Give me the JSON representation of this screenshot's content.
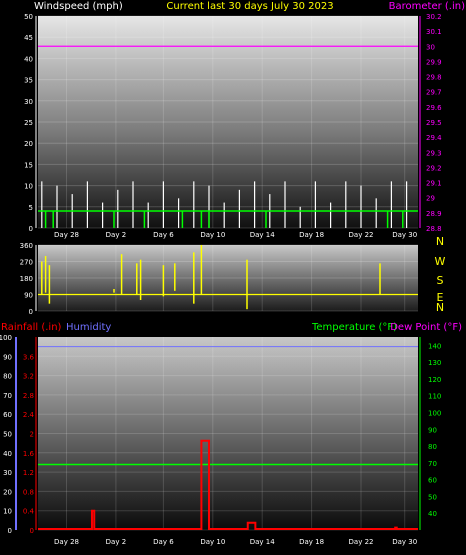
{
  "header": {
    "left": "Windspeed (mph)",
    "center": "Current last 30 days July 30 2023",
    "right": "Barometer (.in)"
  },
  "mid_header": {
    "rain": "Rainfall (.in)",
    "humidity": "Humidity",
    "temperature": "Temperature (°F)",
    "dew": "Dew Point (°F)"
  },
  "colors": {
    "wind": "#ffffff",
    "gust_line": "#ffffff",
    "wind_avg": "#00ff00",
    "barometer": "#ff00ff",
    "direction": "#ffff00",
    "rain": "#ff0000",
    "humidity": "#7070ff",
    "temperature": "#00ff00",
    "dew": "#ff00ff",
    "axis_left": "#ffffff",
    "axis_right_top": "#ff00ff",
    "axis_right_bottom": "#00ff00"
  },
  "chart_data": [
    {
      "type": "line",
      "name": "wind-barometer",
      "xlabels": [
        "Day 28",
        "Day 2",
        "Day 6",
        "Day 10",
        "Day 14",
        "Day 18",
        "Day 22",
        "Day 30"
      ],
      "yleft_ticks": [
        0,
        5,
        10,
        15,
        20,
        25,
        30,
        35,
        40,
        45,
        50
      ],
      "ylim_left": [
        0,
        50
      ],
      "yright_ticks": [
        "28.8",
        "28.9",
        "29",
        "29.1",
        "29.2",
        "29.3",
        "29.4",
        "29.5",
        "29.6",
        "29.7",
        "29.8",
        "29.9",
        "30",
        "30.1",
        "30.2"
      ],
      "ylim_right": [
        28.8,
        30.2
      ],
      "barometer": 30.0,
      "wind_avg": 4,
      "gust_spikes_x": [
        1,
        5,
        9,
        13,
        17,
        21,
        25,
        29,
        33,
        37,
        41,
        45,
        49,
        53,
        57,
        61,
        65,
        69,
        73,
        77,
        81,
        85,
        89,
        93,
        97
      ],
      "gust_spike_values": [
        11,
        10,
        8,
        11,
        6,
        9,
        11,
        6,
        11,
        7,
        11,
        10,
        6,
        9,
        11,
        8,
        11,
        5,
        11,
        6,
        11,
        10,
        7,
        11,
        11
      ]
    },
    {
      "type": "line",
      "name": "wind-direction",
      "ylabels_left": [
        0,
        90,
        180,
        270,
        360
      ],
      "ylabels_right": [
        "N",
        "W",
        "S",
        "E",
        "N"
      ],
      "ylim": [
        0,
        360
      ],
      "baseline": 90,
      "spikes": [
        {
          "x": 1,
          "top": 270,
          "bottom": 90
        },
        {
          "x": 2,
          "top": 300,
          "bottom": 100
        },
        {
          "x": 3,
          "top": 250,
          "bottom": 40
        },
        {
          "x": 20,
          "top": 120,
          "bottom": 100
        },
        {
          "x": 22,
          "top": 310,
          "bottom": 90
        },
        {
          "x": 26,
          "top": 260,
          "bottom": 90
        },
        {
          "x": 27,
          "top": 280,
          "bottom": 60
        },
        {
          "x": 33,
          "top": 250,
          "bottom": 80
        },
        {
          "x": 36,
          "top": 260,
          "bottom": 110
        },
        {
          "x": 41,
          "top": 320,
          "bottom": 40
        },
        {
          "x": 43,
          "top": 360,
          "bottom": 90
        },
        {
          "x": 55,
          "top": 280,
          "bottom": 10
        },
        {
          "x": 90,
          "top": 260,
          "bottom": 90
        }
      ]
    },
    {
      "type": "line",
      "name": "rain-humidity-temp",
      "yleft_hum_ticks": [
        0,
        10,
        20,
        30,
        40,
        50,
        60,
        70,
        80,
        90,
        100
      ],
      "yleft_rain_ticks": [
        "0",
        "0.4",
        "0.8",
        "1.2",
        "1.6",
        "2",
        "2.4",
        "2.8",
        "3.2",
        "3.6"
      ],
      "yright_temp_ticks": [
        40,
        50,
        60,
        70,
        80,
        90,
        100,
        110,
        120,
        130,
        140
      ],
      "ylim_hum": [
        0,
        100
      ],
      "ylim_rain": [
        0,
        4
      ],
      "ylim_temp": [
        30,
        145
      ],
      "humidity": 95,
      "temperature": 69,
      "dew_point": 69,
      "rain_blocks": [
        {
          "x0": 14.2,
          "x1": 14.8,
          "value": 0.4
        },
        {
          "x0": 43.0,
          "x1": 45.0,
          "value": 1.85
        },
        {
          "x0": 55.2,
          "x1": 57.2,
          "value": 0.15
        },
        {
          "x0": 94.0,
          "x1": 94.4,
          "value": 0.05
        }
      ]
    }
  ]
}
